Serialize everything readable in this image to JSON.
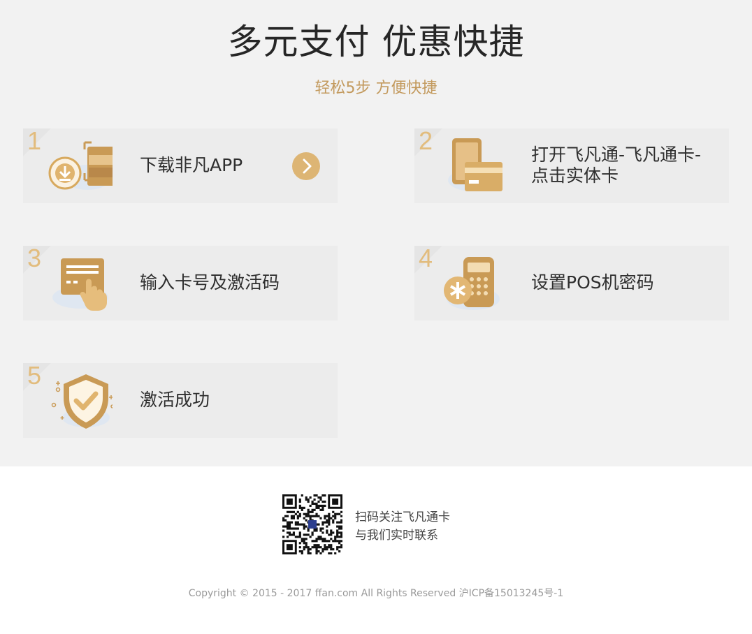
{
  "header": {
    "title": "多元支付 优惠快捷",
    "subtitle": "轻松5步  方便快捷"
  },
  "steps": [
    {
      "number": "1",
      "label": "下载非凡APP",
      "icon": "download-app-icon"
    },
    {
      "number": "2",
      "label_line1": "打开飞凡通-飞凡通卡-",
      "label_line2": "点击实体卡",
      "icon": "phone-card-icon"
    },
    {
      "number": "3",
      "label": "输入卡号及激活码",
      "icon": "card-tap-icon"
    },
    {
      "number": "4",
      "label": "设置POS机密码",
      "icon": "pos-terminal-icon"
    },
    {
      "number": "5",
      "label": "激活成功",
      "icon": "shield-check-icon"
    }
  ],
  "footer": {
    "qr_line1": "扫码关注飞凡通卡",
    "qr_line2": "与我们实时联系",
    "copyright": "Copyright © 2015 - 2017 ffan.com All Rights Reserved    沪ICP备15013245号-1"
  },
  "colors": {
    "accent_gold": "#ddb574",
    "step_number": "#e2bc7d",
    "subtitle": "#c39a5e",
    "background": "#f2f2f2"
  }
}
